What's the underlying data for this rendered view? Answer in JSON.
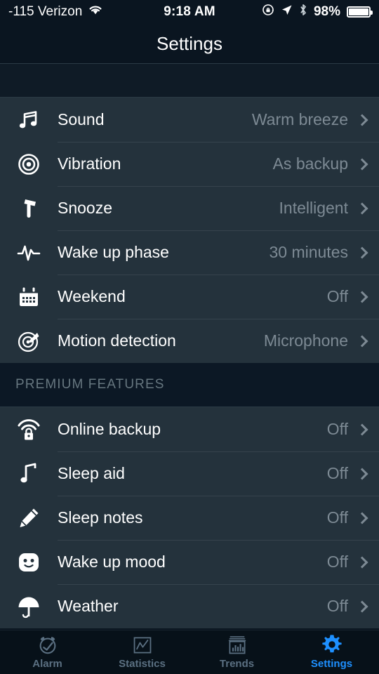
{
  "status_bar": {
    "carrier": "-115 Verizon",
    "wifi_icon": "wifi-icon",
    "time": "9:18 AM",
    "rotation_lock_icon": "rotation-lock-icon",
    "location_icon": "location-arrow-icon",
    "bluetooth_icon": "bluetooth-icon",
    "battery_percent": "98%",
    "battery_icon": "battery-full-icon"
  },
  "navbar": {
    "title": "Settings"
  },
  "sections": [
    {
      "header": null,
      "rows": [
        {
          "icon": "music-note-icon",
          "label": "Sound",
          "value": "Warm breeze"
        },
        {
          "icon": "bullseye-icon",
          "label": "Vibration",
          "value": "As backup"
        },
        {
          "icon": "hammer-icon",
          "label": "Snooze",
          "value": "Intelligent"
        },
        {
          "icon": "pulse-wave-icon",
          "label": "Wake up phase",
          "value": "30 minutes"
        },
        {
          "icon": "calendar-icon",
          "label": "Weekend",
          "value": "Off"
        },
        {
          "icon": "radar-icon",
          "label": "Motion detection",
          "value": "Microphone"
        }
      ]
    },
    {
      "header": "PREMIUM FEATURES",
      "rows": [
        {
          "icon": "wifi-lock-icon",
          "label": "Online backup",
          "value": "Off"
        },
        {
          "icon": "single-note-icon",
          "label": "Sleep aid",
          "value": "Off"
        },
        {
          "icon": "pencil-icon",
          "label": "Sleep notes",
          "value": "Off"
        },
        {
          "icon": "smiley-face-icon",
          "label": "Wake up mood",
          "value": "Off"
        },
        {
          "icon": "umbrella-icon",
          "label": "Weather",
          "value": "Off"
        }
      ]
    }
  ],
  "tabbar": {
    "active_color": "#1e90ff",
    "inactive_color": "#5b7082",
    "tabs": [
      {
        "icon": "alarm-clock-icon",
        "label": "Alarm",
        "active": false
      },
      {
        "icon": "line-chart-icon",
        "label": "Statistics",
        "active": false
      },
      {
        "icon": "bar-chart-icon",
        "label": "Trends",
        "active": false
      },
      {
        "icon": "gear-icon",
        "label": "Settings",
        "active": true
      }
    ]
  },
  "colors": {
    "page_background": "#0a1520",
    "row_background": "#24332c",
    "row_label": "#ffffff",
    "row_value": "#7d8a94",
    "divider": "#36434d"
  }
}
